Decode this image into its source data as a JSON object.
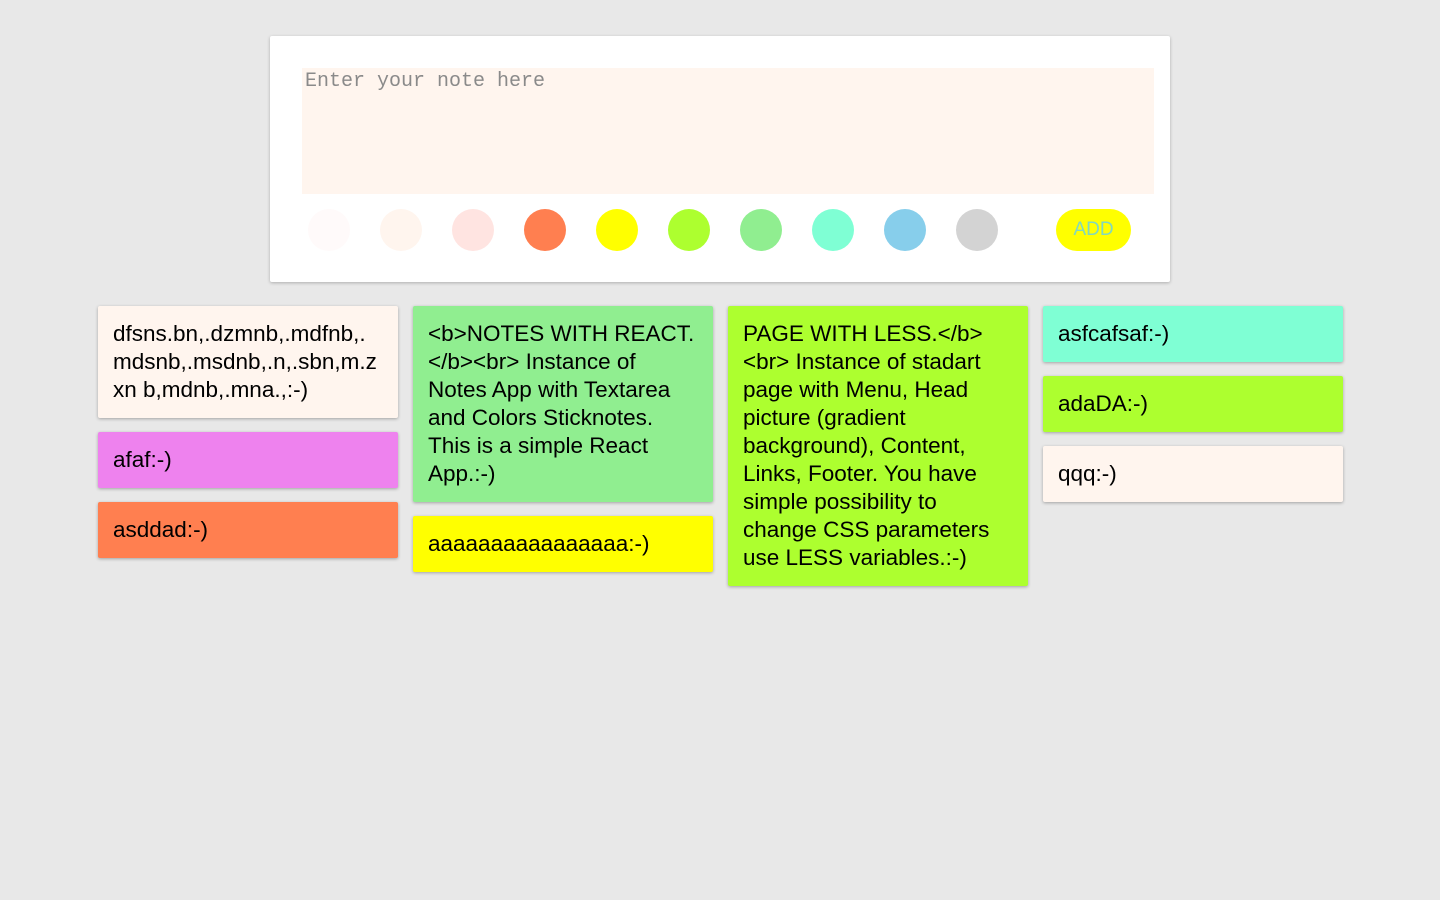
{
  "editor": {
    "placeholder": "Enter your note here",
    "input_bg": "#fff5ee",
    "swatches": [
      {
        "color": "#fffafa"
      },
      {
        "color": "#fff5ee"
      },
      {
        "color": "#ffe4e1"
      },
      {
        "color": "#ff7f50"
      },
      {
        "color": "#ffff00"
      },
      {
        "color": "#adff2f"
      },
      {
        "color": "#90ee90"
      },
      {
        "color": "#7fffd4"
      },
      {
        "color": "#87ceeb"
      },
      {
        "color": "#d3d3d3"
      }
    ],
    "add_label": "ADD",
    "add_bg": "#ffff00",
    "add_text_color": "#80d8c0"
  },
  "columns": [
    [
      {
        "text": "dfsns.bn,.dzmnb,.mdfnb,.mdsnb,.msdnb,.n,.sbn,m.zxn b,mdnb,.mna.,:-)",
        "color": "#fff5ee"
      },
      {
        "text": "afaf:-)",
        "color": "#ee82ee"
      },
      {
        "text": "asddad:-)",
        "color": "#ff7f50"
      }
    ],
    [
      {
        "text": "<b>NOTES WITH REACT.</b><br> Instance of Notes App with Textarea and Colors Sticknotes. This is a simple React App.:-)",
        "color": "#90ee90"
      },
      {
        "text": "aaaaaaaaaaaaaaaa:-)",
        "color": "#ffff00"
      }
    ],
    [
      {
        "text": "PAGE WITH LESS.</b><br> Instance of stadart page with Menu, Head picture (gradient background), Content, Links, Footer. You have simple possibility to change CSS parameters use LESS variables.:-)",
        "color": "#adff2f"
      }
    ],
    [
      {
        "text": "asfcafsaf:-)",
        "color": "#7fffd4"
      },
      {
        "text": "adaDA:-)",
        "color": "#adff2f"
      },
      {
        "text": "qqq:-)",
        "color": "#fff5ee"
      }
    ]
  ]
}
